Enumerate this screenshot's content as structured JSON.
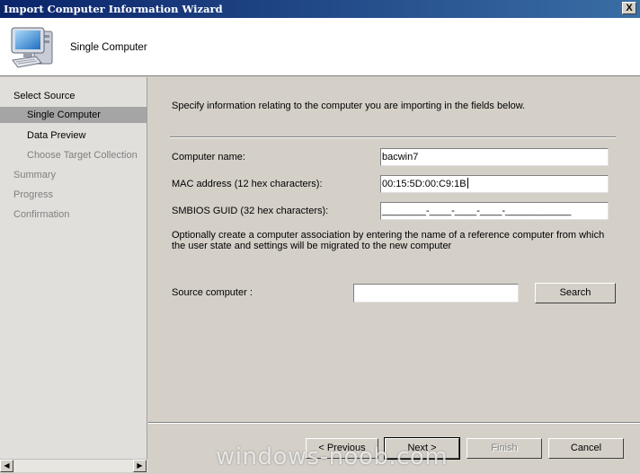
{
  "window": {
    "title": "Import Computer Information Wizard",
    "close_label": "X"
  },
  "header": {
    "title": "Single Computer",
    "icon": "computer-icon"
  },
  "sidebar": {
    "items": [
      {
        "label": "Select Source",
        "state": "enabled"
      },
      {
        "label": "Single Computer",
        "state": "selected"
      },
      {
        "label": "Data Preview",
        "state": "enabled"
      },
      {
        "label": "Choose Target Collection",
        "state": "disabled"
      },
      {
        "label": "Summary",
        "state": "disabled"
      },
      {
        "label": "Progress",
        "state": "disabled"
      },
      {
        "label": "Confirmation",
        "state": "disabled"
      }
    ],
    "scroll_left_label": "◀",
    "scroll_right_label": "▶"
  },
  "main": {
    "instruction": "Specify information relating to the computer you are importing in the fields below.",
    "fields": {
      "computer_name": {
        "label": "Computer name:",
        "value": "bacwin7"
      },
      "mac_address": {
        "label": "MAC address (12 hex characters):",
        "value": "00:15:5D:00:C9:1B"
      },
      "smbios_guid": {
        "label": "SMBIOS GUID (32 hex characters):",
        "value": "________-____-____-____-____________"
      }
    },
    "optional_text": "Optionally create a computer association by entering the name of a reference computer from which the user state and settings will be migrated to the new computer",
    "source_computer": {
      "label": "Source computer :",
      "value": ""
    },
    "search_label": "Search"
  },
  "buttons": {
    "previous": "< Previous",
    "next": "Next >",
    "finish": "Finish",
    "cancel": "Cancel"
  },
  "watermark": "windows-noob.com",
  "colors": {
    "title_gradient_start": "#0a246a",
    "title_gradient_end": "#3a6ea5",
    "sidebar_bg": "#e1dfdb",
    "sidebar_selected": "#a5a5a5",
    "dialog_bg": "#d4d0c8"
  }
}
